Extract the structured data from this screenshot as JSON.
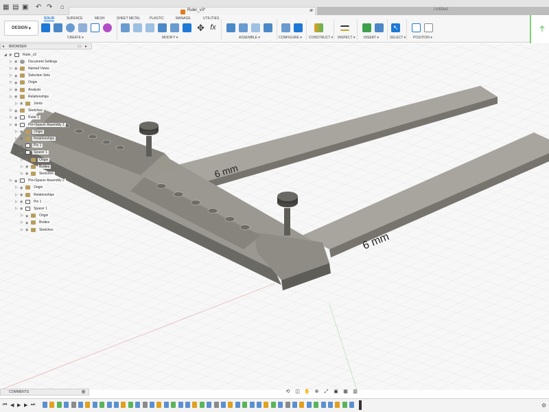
{
  "title_bar": {
    "document_name": "Ruler_v3*",
    "second_tab_label": "Untitled"
  },
  "toolbar": {
    "workspace_button": "DESIGN",
    "workspace_tabs": [
      "SOLID",
      "SURFACE",
      "MESH",
      "SHEET METAL",
      "PLASTIC",
      "MANAGE",
      "UTILITIES"
    ],
    "active_tab": "SOLID",
    "groups": [
      "CREATE",
      "MODIFY",
      "ASSEMBLE",
      "CONFIGURE",
      "CONSTRUCT",
      "INSPECT",
      "INSERT",
      "SELECT",
      "POSITION"
    ]
  },
  "browser": {
    "header": "BROWSER",
    "tree": [
      {
        "label": "Ruler_v3",
        "level": 0,
        "icon": "component-icon"
      },
      {
        "label": "Document Settings",
        "level": 1,
        "icon": "gear-icon"
      },
      {
        "label": "Named Views",
        "level": 1,
        "icon": "folder-icon"
      },
      {
        "label": "Selection Sets",
        "level": 1,
        "icon": "folder-icon"
      },
      {
        "label": "Origin",
        "level": 1,
        "icon": "folder-icon"
      },
      {
        "label": "Analysis",
        "level": 1,
        "icon": "folder-icon"
      },
      {
        "label": "Relationships",
        "level": 1,
        "icon": "folder-icon"
      },
      {
        "label": "Joints",
        "level": 2,
        "icon": "folder-icon"
      },
      {
        "label": "Sketches",
        "level": 1,
        "icon": "folder-icon"
      },
      {
        "label": "Ruler 1",
        "level": 1,
        "icon": "component-icon"
      },
      {
        "label": "Pin+Spacer Assembly 1",
        "level": 1,
        "icon": "component-icon"
      },
      {
        "label": "Origin",
        "level": 2,
        "icon": "folder-icon"
      },
      {
        "label": "Relationships",
        "level": 2,
        "icon": "folder-icon"
      },
      {
        "label": "Pin 1",
        "level": 2,
        "icon": "component-icon"
      },
      {
        "label": "Spacer 1",
        "level": 2,
        "icon": "component-icon"
      },
      {
        "label": "Origin",
        "level": 3,
        "icon": "folder-icon"
      },
      {
        "label": "Bodies",
        "level": 3,
        "icon": "folder-icon"
      },
      {
        "label": "Sketches",
        "level": 3,
        "icon": "folder-icon"
      },
      {
        "label": "Pin+Spacer Assembly 2",
        "level": 1,
        "icon": "component-icon"
      },
      {
        "label": "Origin",
        "level": 2,
        "icon": "folder-icon"
      },
      {
        "label": "Relationships",
        "level": 2,
        "icon": "folder-icon"
      },
      {
        "label": "Pin 1",
        "level": 2,
        "icon": "component-icon"
      },
      {
        "label": "Spacer 1",
        "level": 2,
        "icon": "component-icon"
      },
      {
        "label": "Origin",
        "level": 3,
        "icon": "folder-icon"
      },
      {
        "label": "Bodies",
        "level": 3,
        "icon": "folder-icon"
      },
      {
        "label": "Sketches",
        "level": 3,
        "icon": "folder-icon"
      }
    ]
  },
  "viewport": {
    "labels": [
      "6 mm",
      "6 mm"
    ]
  },
  "comments": {
    "label": "COMMENTS"
  },
  "colors": {
    "accent": "#1d78d6",
    "model": "#8e8c86",
    "grid": "#d6d6d6"
  }
}
